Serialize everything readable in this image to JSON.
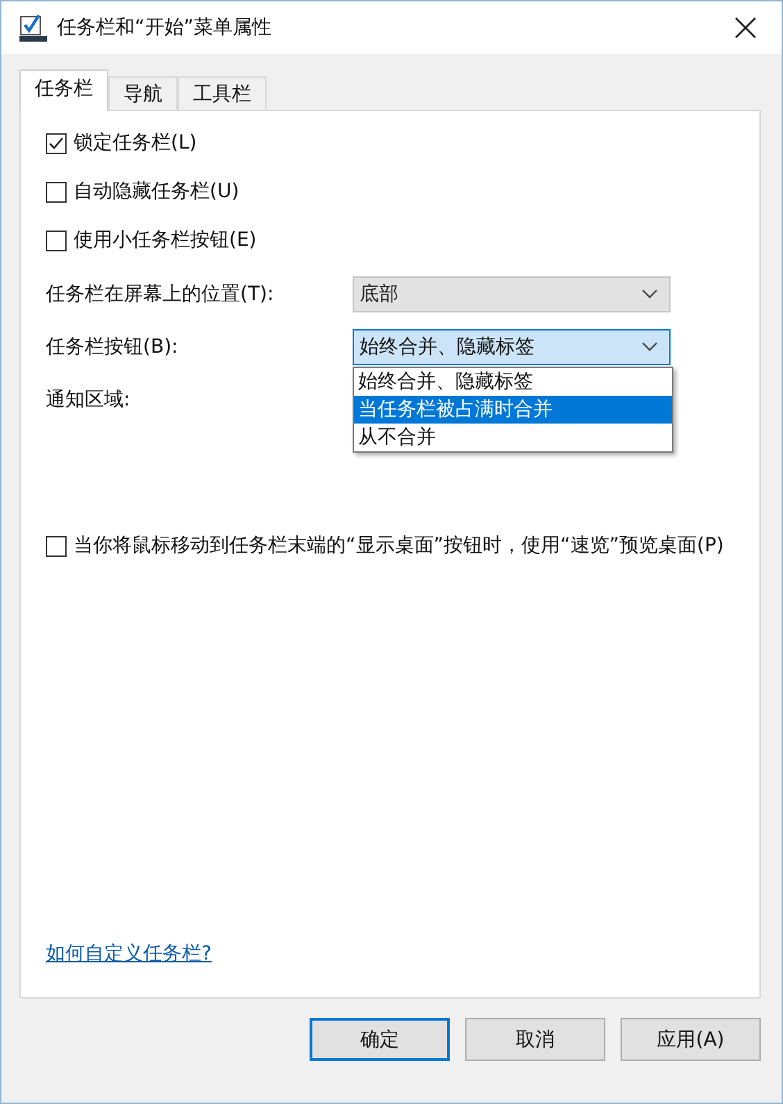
{
  "window": {
    "title": "任务栏和“开始”菜单属性"
  },
  "tabs": [
    {
      "label": "任务栏",
      "selected": true
    },
    {
      "label": "导航",
      "selected": false
    },
    {
      "label": "工具栏",
      "selected": false
    }
  ],
  "checkboxes": [
    {
      "label": "锁定任务栏(L)",
      "checked": true
    },
    {
      "label": "自动隐藏任务栏(U)",
      "checked": false
    },
    {
      "label": "使用小任务栏按钮(E)",
      "checked": false
    }
  ],
  "settings": [
    {
      "kind": "combo",
      "label": "任务栏在屏幕上的位置(T):",
      "value": "底部",
      "disabled": true,
      "expanded": false
    },
    {
      "kind": "combo",
      "label": "任务栏按钮(B):",
      "value": "始终合并、隐藏标签",
      "disabled": false,
      "expanded": true,
      "options": [
        {
          "label": "始终合并、隐藏标签",
          "highlighted": false
        },
        {
          "label": "当任务栏被占满时合并",
          "highlighted": true
        },
        {
          "label": "从不合并",
          "highlighted": false
        }
      ]
    },
    {
      "kind": "label",
      "label": "通知区域:"
    }
  ],
  "peek": {
    "label": "当你将鼠标移动到任务栏末端的“显示桌面”按钮时，使用“速览”预览桌面(P)",
    "checked": false
  },
  "help_link": "如何自定义任务栏?",
  "buttons": [
    {
      "label": "确定",
      "default": true
    },
    {
      "label": "取消",
      "default": false
    },
    {
      "label": "应用(A)",
      "default": false
    }
  ]
}
